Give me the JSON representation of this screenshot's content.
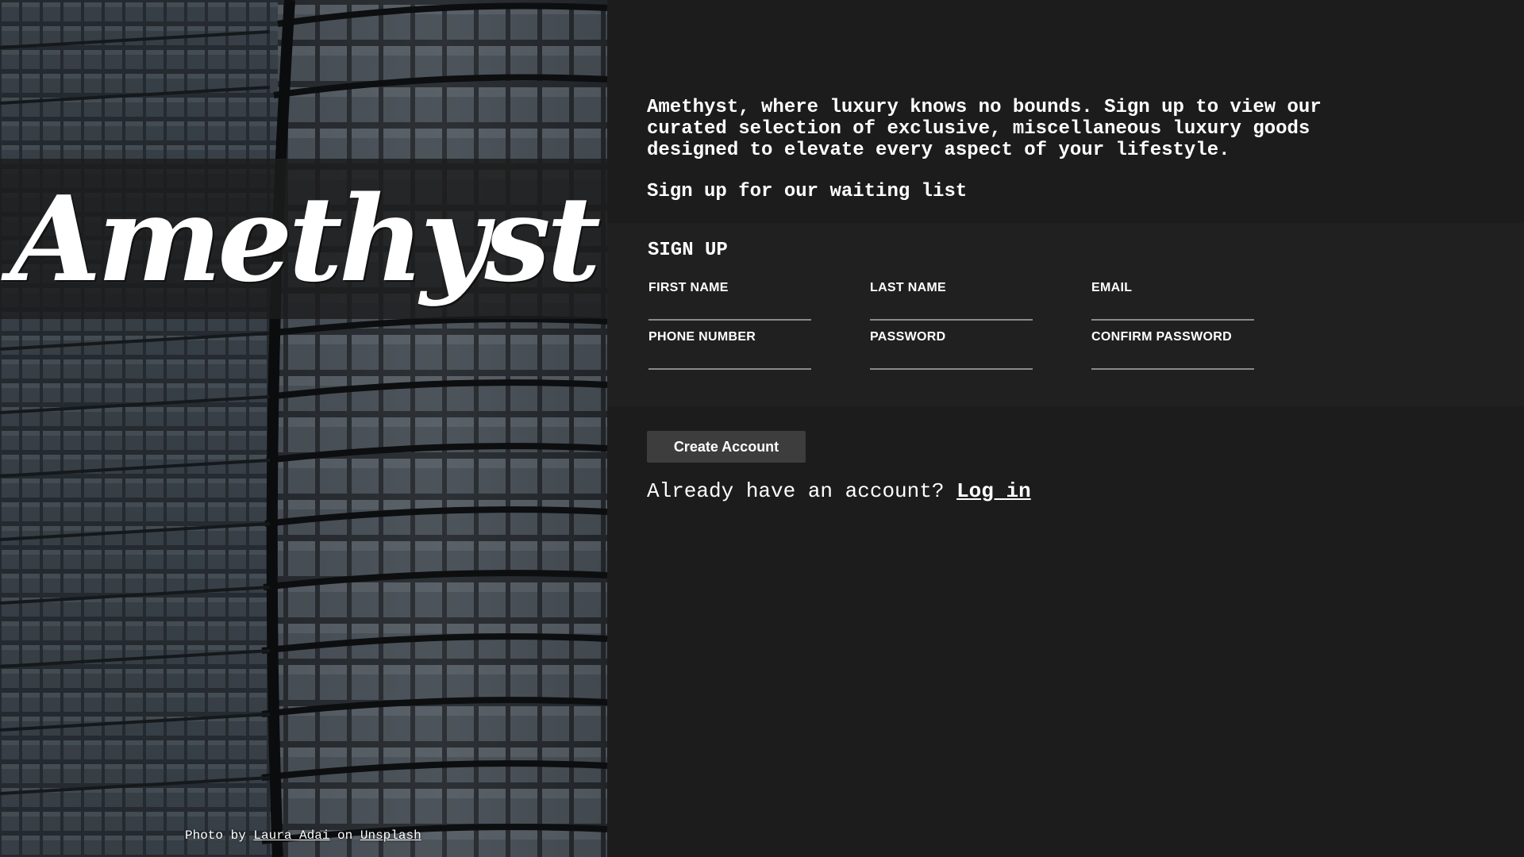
{
  "brand": {
    "logo_text": "Amethyst"
  },
  "photo_credit": {
    "prefix": "Photo by",
    "author": "Laura Adai",
    "middle": "on",
    "source": "Unsplash"
  },
  "intro": {
    "text": "Amethyst, where luxury knows no bounds. Sign up to view our curated selection of exclusive, miscellaneous luxury goods designed to elevate every aspect of your lifestyle.",
    "waitlist": "Sign up for our waiting list"
  },
  "form": {
    "title": "SIGN UP",
    "fields": [
      {
        "label": "FIRST NAME",
        "value": ""
      },
      {
        "label": "LAST NAME",
        "value": ""
      },
      {
        "label": "EMAIL",
        "value": ""
      },
      {
        "label": "PHONE NUMBER",
        "value": ""
      },
      {
        "label": "PASSWORD",
        "value": ""
      },
      {
        "label": "CONFIRM PASSWORD",
        "value": ""
      }
    ],
    "submit_label": "Create Account"
  },
  "login": {
    "prompt": "Already have an account?",
    "link_label": "Log in"
  },
  "colors": {
    "background": "#1d1c1d",
    "form_panel": "#202020",
    "button": "#3d3d3d",
    "text": "#ffffff"
  }
}
